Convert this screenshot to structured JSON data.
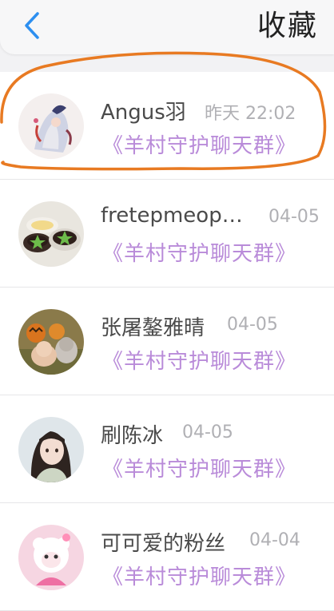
{
  "header": {
    "title": "收藏",
    "back_icon": "chevron-left-icon",
    "accent": "#2d8ff0"
  },
  "items": [
    {
      "name": "Angus羽",
      "date": "昨天 22:02",
      "group": "《羊村守护聊天群》",
      "avatar": "anime-character"
    },
    {
      "name": "fretepmeop…",
      "date": "04-05",
      "group": "《羊村守护聊天群》",
      "avatar": "desserts"
    },
    {
      "name": "张屠鏊雅晴",
      "date": "04-05",
      "group": "《羊村守护聊天群》",
      "avatar": "child-pumpkins"
    },
    {
      "name": "刷陈冰",
      "date": "04-05",
      "group": "《羊村守护聊天群》",
      "avatar": "girl-portrait"
    },
    {
      "name": "可可爱的粉丝",
      "date": "04-04",
      "group": "《羊村守护聊天群》",
      "avatar": "pink-sheep"
    }
  ],
  "colors": {
    "group_text": "#b98bd9",
    "highlight_stroke": "#e87a22"
  }
}
